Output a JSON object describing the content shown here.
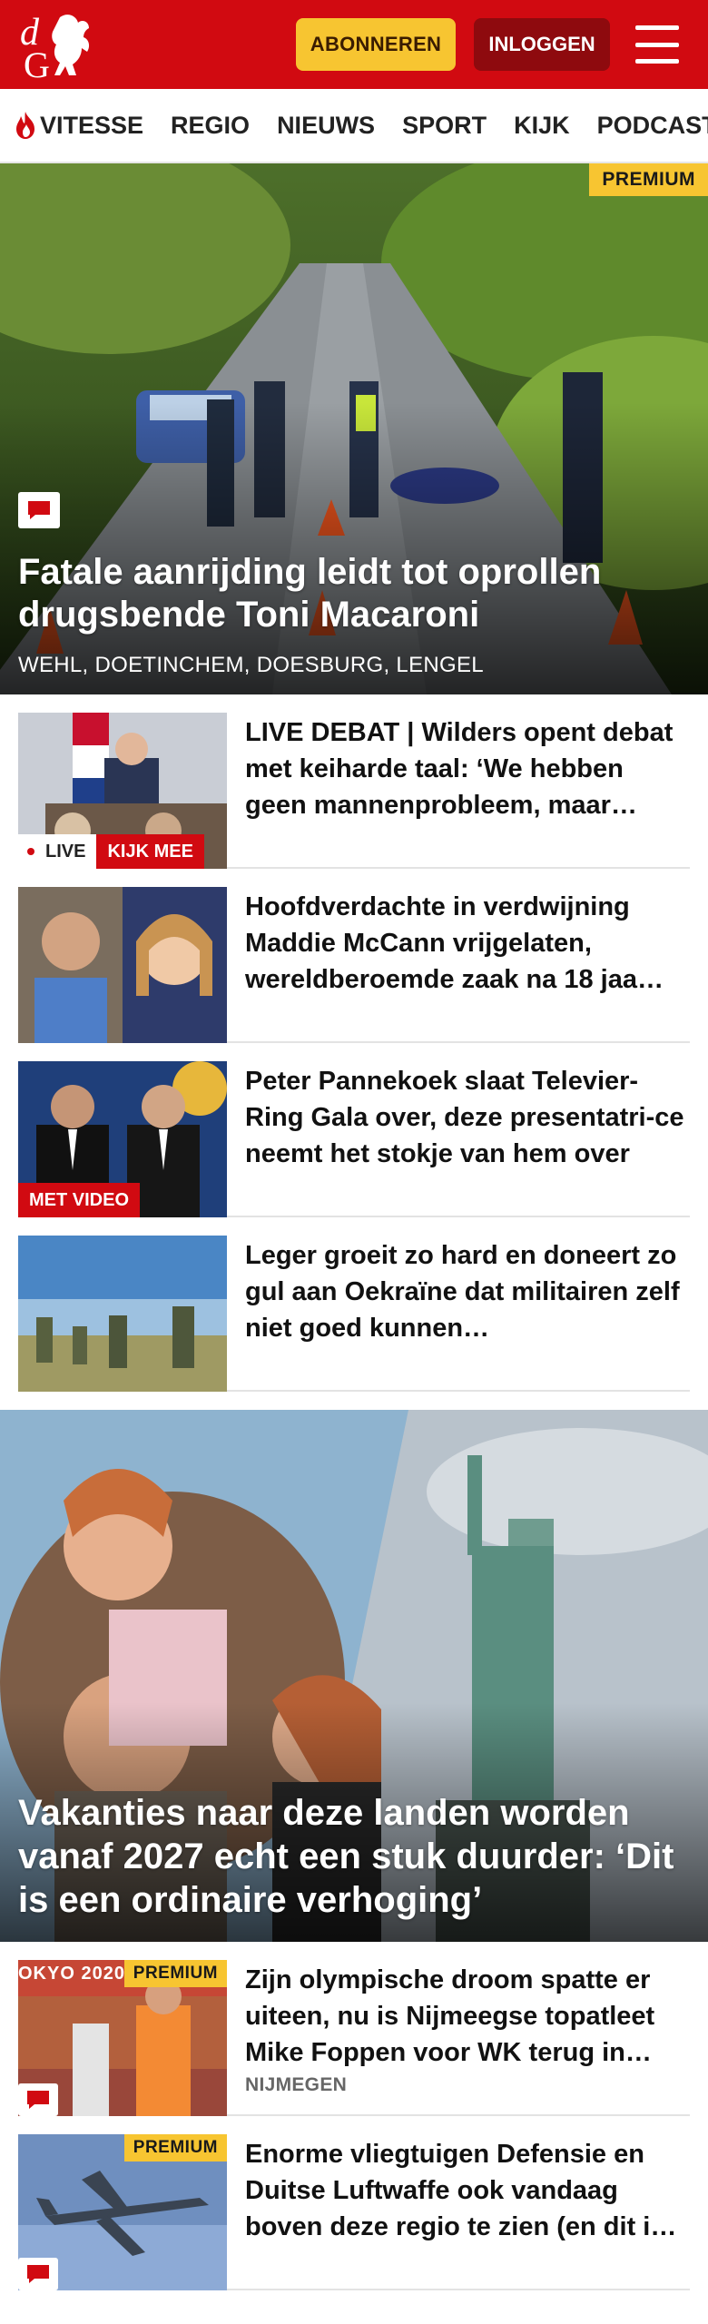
{
  "header": {
    "subscribe_label": "ABONNEREN",
    "login_label": "INLOGGEN",
    "logo_letters": "dG"
  },
  "nav": {
    "items": [
      "VITESSE",
      "REGIO",
      "NIEUWS",
      "SPORT",
      "KIJK",
      "PODCAST"
    ]
  },
  "hero": {
    "tag": "PREMIUM",
    "title": "Fatale aanrijding leidt tot oprollen drugsbende Toni Macaroni",
    "location": "WEHL, DOETINCHEM, DOESBURG, LENGEL"
  },
  "articles": [
    {
      "title": "LIVE DEBAT | Wilders opent debat met keiharde taal: ‘We hebben geen mannenprobleem, maar…",
      "live_label": "LIVE",
      "kijk_label": "KIJK MEE"
    },
    {
      "title": "Hoofdverdachte in verdwijning Maddie McCann vrijgelaten, wereldberoemde zaak na 18 jaa…"
    },
    {
      "title": "Peter Pannekoek slaat Televier-Ring Gala over, deze presentatri-ce neemt het stokje van hem over",
      "video_label": "MET VIDEO"
    },
    {
      "title": "Leger groeit zo hard en doneert zo gul aan Oekraïne dat militairen zelf niet goed kunnen…"
    }
  ],
  "feature": {
    "title": "Vakanties naar deze landen worden vanaf 2027 echt een stuk duurder: ‘Dit is een ordinaire verhoging’"
  },
  "articles2": [
    {
      "title": "Zijn olympische droom spatte er uiteen, nu is Nijmeegse topatleet Mike Foppen voor WK terug in…",
      "meta": "NIJMEGEN",
      "tag": "PREMIUM",
      "thumb_text": "OKYO 2020"
    },
    {
      "title": "Enorme vliegtuigen Defensie en Duitse Luftwaffe ook vandaag boven deze regio te zien (en dit i…",
      "tag": "PREMIUM"
    }
  ],
  "colors": {
    "brand_red": "#d10a11",
    "premium_yellow": "#f7c531",
    "login_dark_red": "#8e0a0e"
  }
}
